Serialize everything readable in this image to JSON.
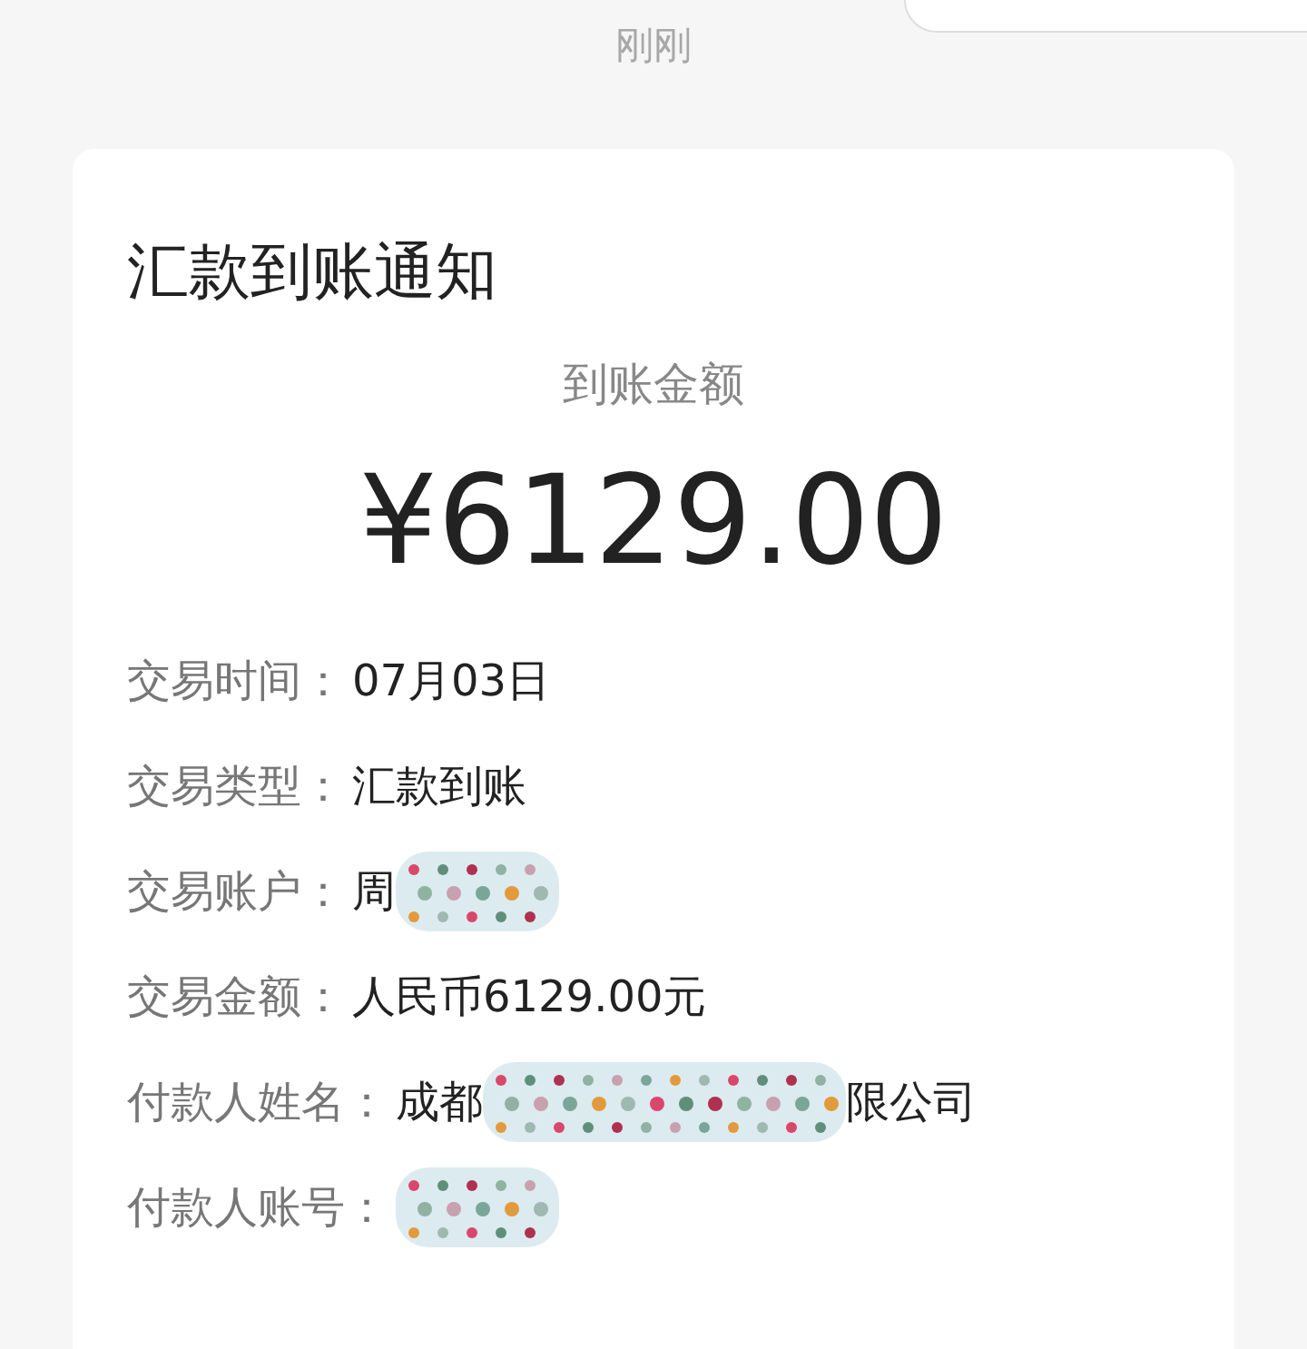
{
  "time": "刚刚",
  "card": {
    "title": "汇款到账通知",
    "amount_label": "到账金额",
    "amount": "¥6129.00",
    "rows": [
      {
        "label": "交易时间：",
        "value_parts": [
          "07月03日"
        ],
        "redacted": false
      },
      {
        "label": "交易类型：",
        "value_parts": [
          "汇款到账"
        ],
        "redacted": false
      },
      {
        "label": "交易账户：",
        "value_parts": [
          "周"
        ],
        "redacted": true
      },
      {
        "label": "交易金额：",
        "value_parts": [
          "人民币6129.00元"
        ],
        "redacted": false
      },
      {
        "label": "付款人姓名：",
        "value_parts": [
          "成都",
          "限公司"
        ],
        "redacted": true
      },
      {
        "label": "付款人账号：",
        "redacted": true
      }
    ]
  }
}
